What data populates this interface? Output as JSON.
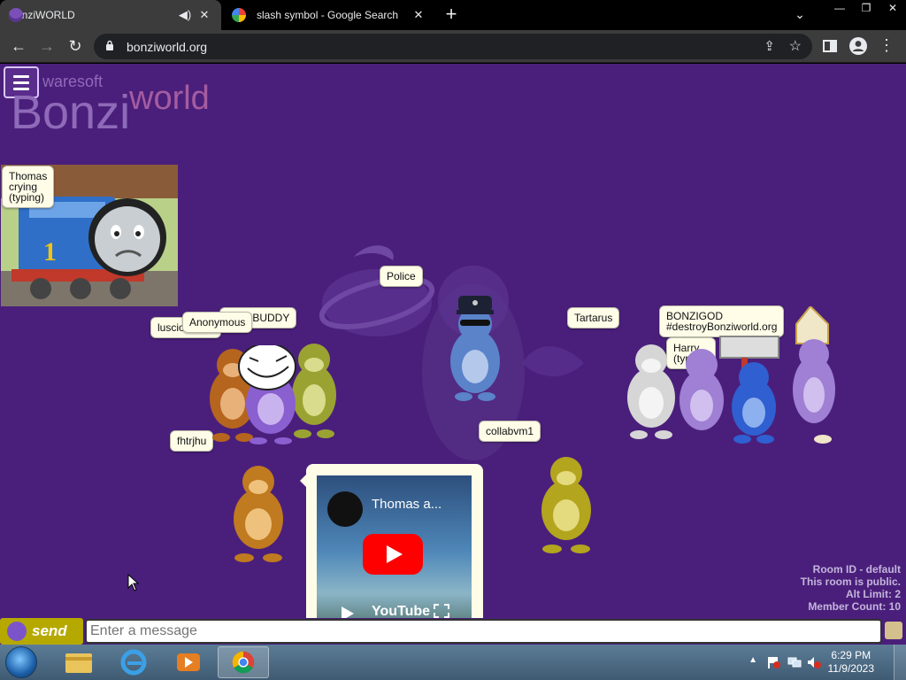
{
  "browser": {
    "tabs": [
      {
        "title": "BonziWORLD",
        "active": true
      },
      {
        "title": "slash symbol - Google Search",
        "active": false
      }
    ],
    "url": "bonziworld.org"
  },
  "logo": {
    "soft": "waresoft",
    "bonzi": "Bonzi",
    "world": "world"
  },
  "bubbles": {
    "thomas": [
      "Thomas",
      "crying",
      "(typing)"
    ],
    "luscious": "luscio",
    "anonymous": "Anonymous",
    "bonzibuddy": "IBUDDY",
    "police": "Police",
    "tartarus": "Tartarus",
    "bonzigod": [
      "BONZIGOD",
      "#destroyBonziworld.org"
    ],
    "harry": [
      "Harry",
      "(typing)"
    ],
    "fhtrjhu": "fhtrjhu",
    "collabvm": "collabvm1"
  },
  "video": {
    "title": "Thomas a...",
    "brand": "YouTube"
  },
  "room": {
    "id": "Room ID - default",
    "status": "This room is public.",
    "alt_limit": "Alt Limit: 2",
    "member_count": "Member Count: 10"
  },
  "chat": {
    "send_label": "send",
    "placeholder": "Enter a message"
  },
  "taskbar": {
    "time": "6:29 PM",
    "date": "11/9/2023"
  },
  "colors": {
    "background": "#4a1f7b",
    "bubble": "#fffde8",
    "send_button": "#b5a900"
  }
}
